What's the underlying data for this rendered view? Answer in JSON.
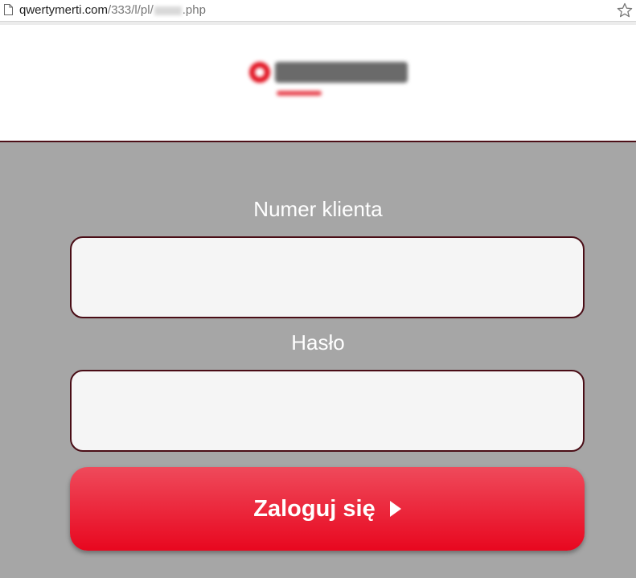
{
  "browser": {
    "url_main": "qwertymerti.com",
    "url_path": "/333/l/pl/",
    "url_ext": ".php"
  },
  "header": {
    "logo": "bank-logo"
  },
  "form": {
    "client_number_label": "Numer klienta",
    "client_number_value": "",
    "password_label": "Hasło",
    "password_value": "",
    "login_button_label": "Zaloguj się"
  },
  "colors": {
    "background": "#a6a6a6",
    "field_border": "#4a0d16",
    "button_top": "#ef4a5b",
    "button_bottom": "#e8071f"
  }
}
